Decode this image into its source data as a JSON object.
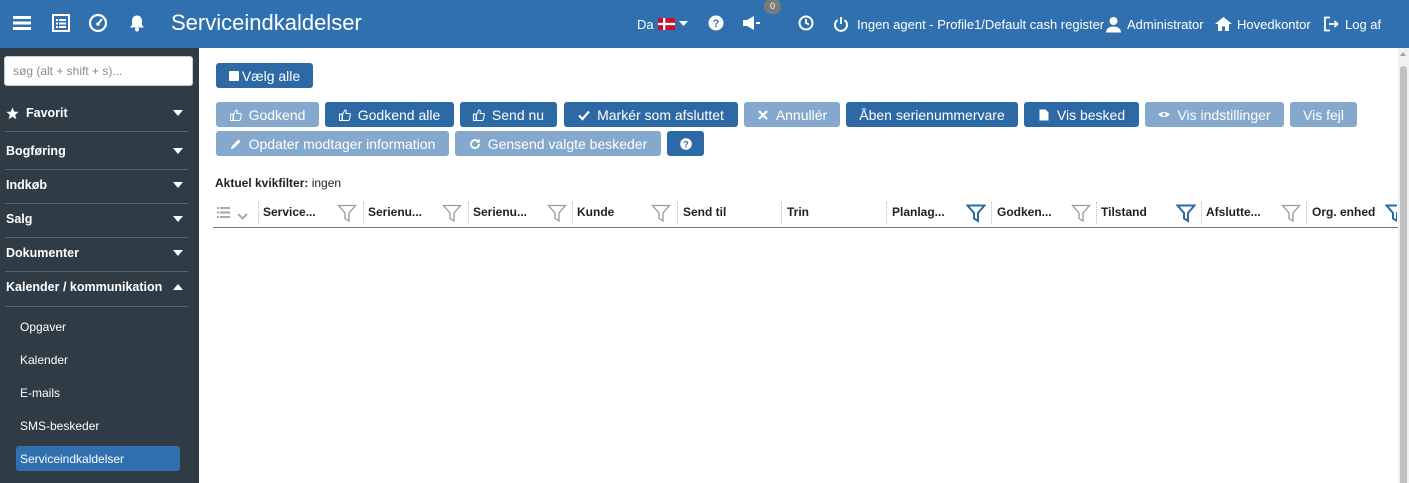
{
  "header": {
    "title": "Serviceindkaldelser",
    "language": "Da",
    "notifications_count": "0",
    "agent_status": "Ingen agent - Profile1/Default cash register",
    "user": "Administrator",
    "location": "Hovedkontor",
    "logout": "Log af",
    "icons": [
      "menu-icon",
      "list-icon",
      "dashboard-icon",
      "bell-icon",
      "help-icon",
      "megaphone-icon",
      "clock-icon",
      "power-icon",
      "user-icon",
      "home-icon",
      "logout-icon"
    ]
  },
  "sidebar": {
    "search_placeholder": "søg (alt + shift + s)...",
    "sections": [
      "Favorit",
      "Bogføring",
      "Indkøb",
      "Salg",
      "Dokumenter",
      "Kalender / kommunikation"
    ],
    "subitems": [
      "Opgaver",
      "Kalender",
      "E-mails",
      "SMS-beskeder",
      "Serviceindkaldelser"
    ],
    "active_subitem": "Serviceindkaldelser"
  },
  "toolbar": {
    "select_all": "Vælg alle",
    "row1": [
      "Godkend",
      "Godkend alle",
      "Send nu",
      "Markér som afsluttet",
      "Annullér",
      "Åben serienummervare",
      "Vis besked",
      "Vis indstillinger",
      "Vis fejl"
    ],
    "row2": [
      "Opdater modtager information",
      "Gensend valgte beskeder"
    ]
  },
  "quickfilter": {
    "label": "Aktuel kvikfilter:",
    "value": "ingen"
  },
  "table": {
    "columns": [
      "Service...",
      "Serienu...",
      "Serienu...",
      "Kunde",
      "Send til",
      "Trin",
      "Planlag...",
      "Godken...",
      "Tilstand",
      "Afslutte...",
      "Org. enhed"
    ]
  },
  "colors": {
    "topbar": "#3170ae",
    "sidebar": "#2f3b45",
    "button_dark": "#2d6aa5",
    "button_light": "#85a9cd",
    "filter_active": "#2d6aa5",
    "filter_inactive": "#9a9a9a"
  }
}
